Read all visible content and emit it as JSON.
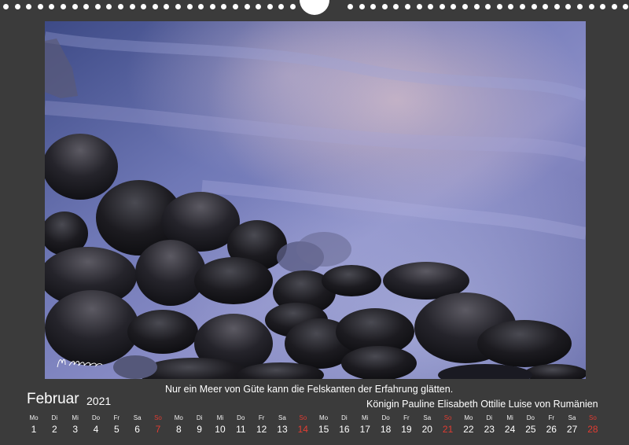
{
  "calendar": {
    "month": "Februar",
    "year": "2021",
    "quote": "Nur ein Meer von Güte kann die Felskanten der Erfahrung glätten.",
    "author": "Königin Pauline Elisabeth Ottilie Luise von Rumänien",
    "signature": "Hannah Wochhausen",
    "days": [
      {
        "name": "Mo",
        "num": "1"
      },
      {
        "name": "Di",
        "num": "2"
      },
      {
        "name": "Mi",
        "num": "3"
      },
      {
        "name": "Do",
        "num": "4"
      },
      {
        "name": "Fr",
        "num": "5"
      },
      {
        "name": "Sa",
        "num": "6"
      },
      {
        "name": "So",
        "num": "7"
      },
      {
        "name": "Mo",
        "num": "8"
      },
      {
        "name": "Di",
        "num": "9"
      },
      {
        "name": "Mi",
        "num": "10"
      },
      {
        "name": "Do",
        "num": "11"
      },
      {
        "name": "Fr",
        "num": "12"
      },
      {
        "name": "Sa",
        "num": "13"
      },
      {
        "name": "So",
        "num": "14"
      },
      {
        "name": "Mo",
        "num": "15"
      },
      {
        "name": "Di",
        "num": "16"
      },
      {
        "name": "Mi",
        "num": "17"
      },
      {
        "name": "Do",
        "num": "18"
      },
      {
        "name": "Fr",
        "num": "19"
      },
      {
        "name": "Sa",
        "num": "20"
      },
      {
        "name": "So",
        "num": "21"
      },
      {
        "name": "Mo",
        "num": "22"
      },
      {
        "name": "Di",
        "num": "23"
      },
      {
        "name": "Mi",
        "num": "24"
      },
      {
        "name": "Do",
        "num": "25"
      },
      {
        "name": "Fr",
        "num": "26"
      },
      {
        "name": "Sa",
        "num": "27"
      },
      {
        "name": "So",
        "num": "28"
      }
    ]
  },
  "colors": {
    "background": "#3b3b3b",
    "sunday": "#e03c32",
    "text": "#ffffff"
  }
}
